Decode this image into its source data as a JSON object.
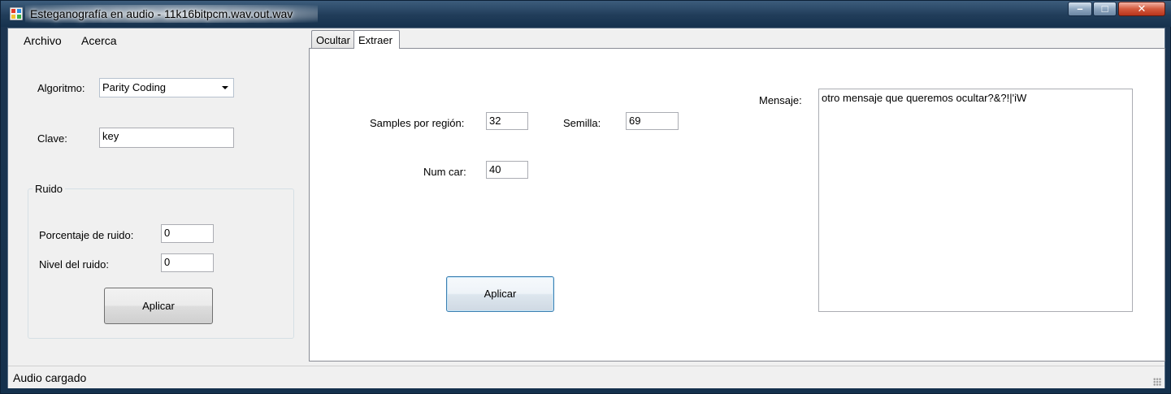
{
  "window": {
    "title": "Esteganografía en audio - 11k16bitpcm.wav.out.wav",
    "controls": {
      "minimize": "–",
      "maximize": "□",
      "close": "✕"
    }
  },
  "menu": {
    "items": [
      "Archivo",
      "Acerca"
    ]
  },
  "left_panel": {
    "algorithm_label": "Algoritmo:",
    "algorithm_value": "Parity Coding",
    "key_label": "Clave:",
    "key_value": "key",
    "noise_group": {
      "title": "Ruido",
      "percent_label": "Porcentaje de ruido:",
      "percent_value": "0",
      "level_label": "Nivel del ruido:",
      "level_value": "0",
      "apply_label": "Aplicar"
    }
  },
  "tabs": [
    {
      "label": "Ocultar",
      "active": false
    },
    {
      "label": "Extraer",
      "active": true
    }
  ],
  "extract_panel": {
    "samples_label": "Samples por región:",
    "samples_value": "32",
    "seed_label": "Semilla:",
    "seed_value": "69",
    "numchar_label": "Num car:",
    "numchar_value": "40",
    "message_label": "Mensaje:",
    "message_value": "otro mensaje que queremos ocultar?&?!|'iW",
    "apply_label": "Aplicar"
  },
  "status": {
    "text": "Audio cargado"
  },
  "colors": {
    "title_bar": "#213d5a",
    "client_bg": "#f0f0f0",
    "focus_border": "#3c7fb1",
    "close_button": "#d35a3e"
  }
}
